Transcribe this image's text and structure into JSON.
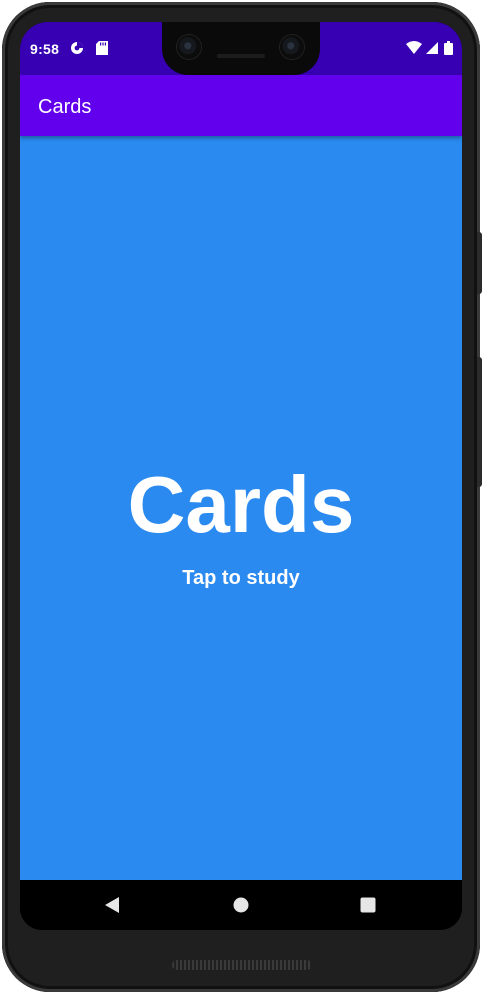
{
  "status_bar": {
    "time": "9:58",
    "left_icons": [
      "data-saver-icon",
      "sd-card-icon"
    ],
    "right_icons": [
      "wifi-icon",
      "cell-signal-icon",
      "battery-icon"
    ],
    "background": "#3700b3"
  },
  "app_bar": {
    "title": "Cards",
    "background": "#6200ee"
  },
  "main": {
    "deck_title": "Cards",
    "subtitle": "Tap to study",
    "background": "#2a8af0"
  },
  "nav_bar": {
    "buttons": [
      "back-icon",
      "home-icon",
      "recents-icon"
    ]
  }
}
